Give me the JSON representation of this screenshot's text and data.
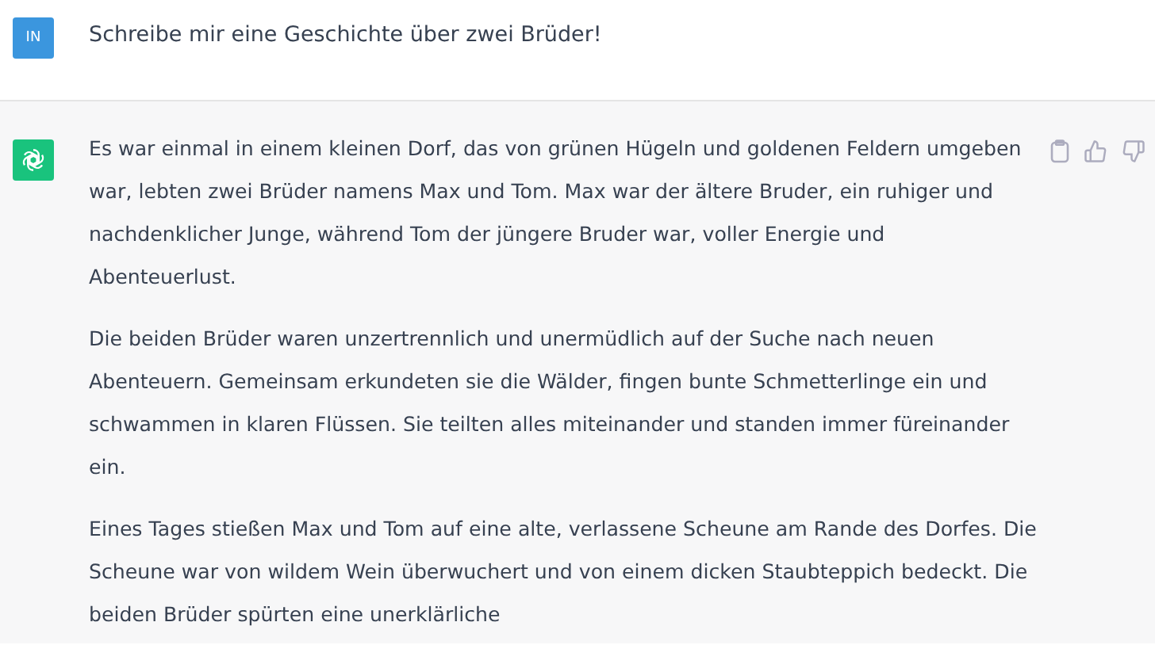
{
  "user_message": {
    "avatar": "IN",
    "text": "Schreibe mir eine Geschichte über zwei Brüder!"
  },
  "assistant_message": {
    "paragraphs": [
      "Es war einmal in einem kleinen Dorf, das von grünen Hügeln und goldenen Feldern umgeben war, lebten zwei Brüder namens Max und Tom. Max war der ältere Bruder, ein ruhiger und nachdenklicher Junge, während Tom der jüngere Bruder war, voller Energie und Abenteuerlust.",
      "Die beiden Brüder waren unzertrennlich und unermüdlich auf der Suche nach neuen Abenteuern. Gemeinsam erkundeten sie die Wälder, fingen bunte Schmetterlinge ein und schwammen in klaren Flüssen. Sie teilten alles miteinander und standen immer füreinander ein.",
      "Eines Tages stießen Max und Tom auf eine alte, verlassene Scheune am Rande des Dorfes. Die Scheune war von wildem Wein überwuchert und von einem dicken Staubteppich bedeckt. Die beiden Brüder spürten eine unerklärliche"
    ]
  }
}
